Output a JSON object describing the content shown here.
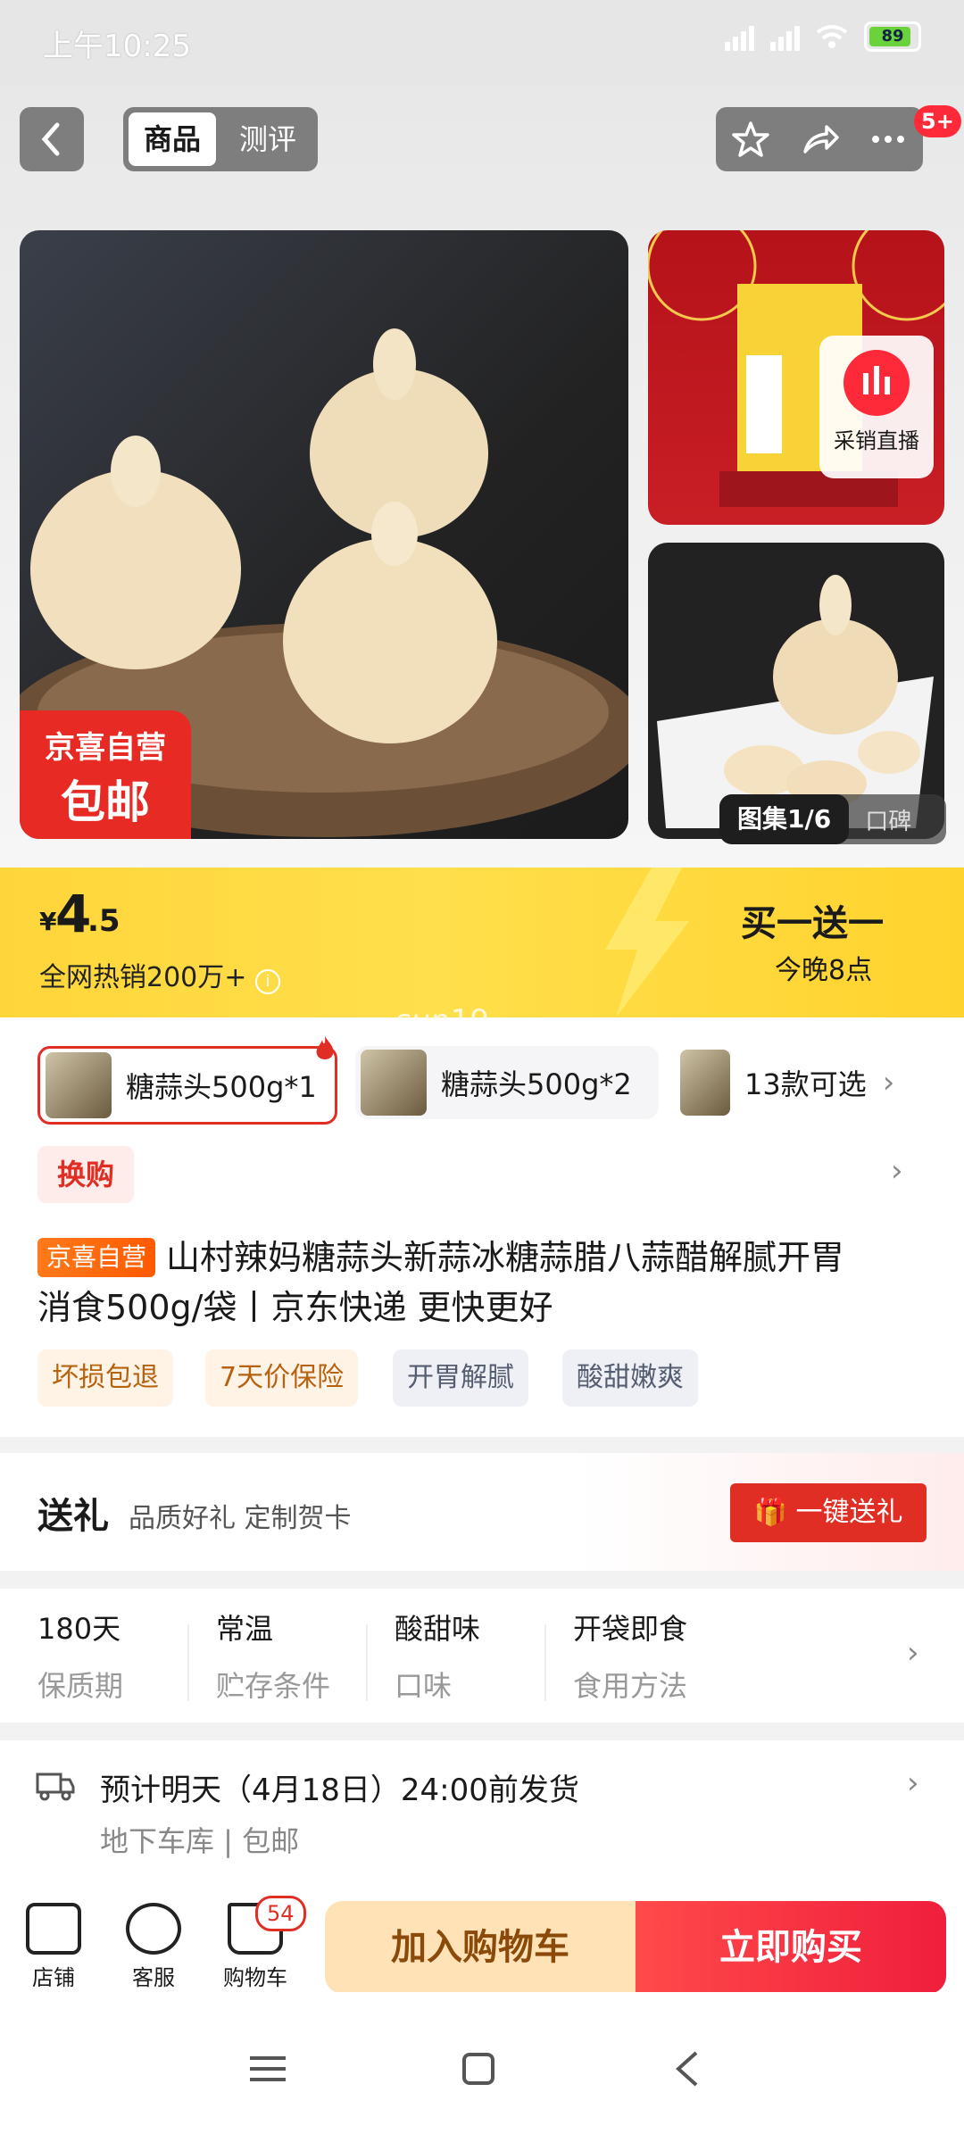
{
  "status_bar": {
    "time": "上午10:25",
    "battery": "89"
  },
  "header": {
    "tabs": [
      "商品",
      "测评"
    ],
    "message_badge": "5+"
  },
  "gallery": {
    "badge_top": "京喜自营",
    "badge_bottom": "包邮",
    "live_label": "采销直播",
    "counter": "图集1/6",
    "review_tab": "口碑",
    "watermark": "sun19"
  },
  "price": {
    "currency": "¥",
    "integer": "4",
    "decimal": ".5",
    "sold": "全网热销200万+",
    "promo_title": "买一送一",
    "promo_time": "今晚8点"
  },
  "skus": [
    {
      "label": "糖蒜头500g*1"
    },
    {
      "label": "糖蒜头500g*2"
    },
    {
      "label": "13款可选"
    }
  ],
  "exchange": "换购",
  "product": {
    "tag": "京喜自营",
    "title_line1": "山村辣妈糖蒜头新蒜冰糖蒜腊八蒜醋解腻开胃",
    "title_line2": "消食500g/袋丨京东快递 更快更好",
    "tags": [
      "坏损包退",
      "7天价保险",
      "开胃解腻",
      "酸甜嫩爽"
    ]
  },
  "gift": {
    "title": "送礼",
    "subtitle": "品质好礼 定制贺卡",
    "button": "一键送礼"
  },
  "attributes": [
    {
      "value": "180天",
      "key": "保质期"
    },
    {
      "value": "常温",
      "key": "贮存条件"
    },
    {
      "value": "酸甜味",
      "key": "口味"
    },
    {
      "value": "开袋即食",
      "key": "食用方法"
    }
  ],
  "delivery": {
    "line1": "预计明天（4月18日）24:00前发货",
    "line2": "地下车库 | 包邮"
  },
  "bottom": {
    "store": "店铺",
    "service": "客服",
    "cart": "购物车",
    "cart_count": "54",
    "add_cart": "加入购物车",
    "buy_now": "立即购买"
  }
}
